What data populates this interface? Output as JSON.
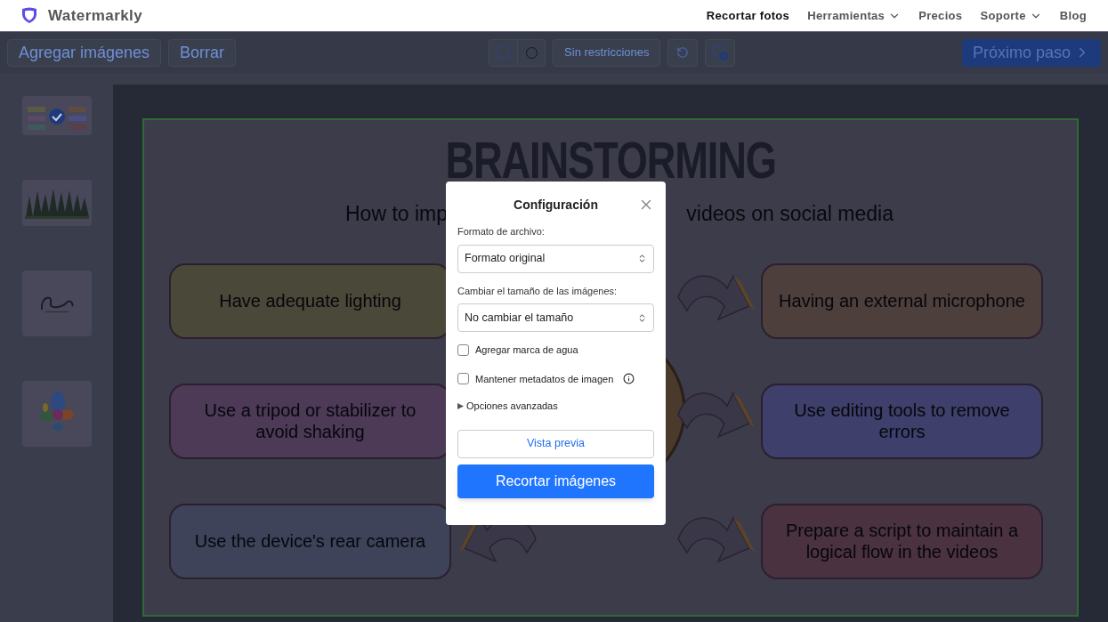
{
  "nav": {
    "brand": "Watermarkly",
    "links": [
      {
        "label": "Recortar fotos",
        "selected": true,
        "dropdown": false
      },
      {
        "label": "Herramientas",
        "selected": false,
        "dropdown": true
      },
      {
        "label": "Precios",
        "selected": false,
        "dropdown": false
      },
      {
        "label": "Soporte",
        "selected": false,
        "dropdown": true
      },
      {
        "label": "Blog",
        "selected": false,
        "dropdown": false
      }
    ]
  },
  "toolbar": {
    "add_button": "Agregar imágenes",
    "delete_button": "Borrar",
    "shapes": [
      {
        "kind": "rectangle",
        "selected": true
      },
      {
        "kind": "ellipse",
        "selected": false
      }
    ],
    "ratio_button": "Sin restricciones",
    "next_button": "Próximo paso"
  },
  "slide": {
    "title": "BRAINSTORMING",
    "subtitle_left": "How to imp",
    "subtitle_right": "videos on social media",
    "left_tips": [
      {
        "text": "Have adequate lighting",
        "color": "#4a4838"
      },
      {
        "text": "Use a tripod or stabilizer to avoid shaking",
        "color": "#4c3a57"
      },
      {
        "text": "Use the device's rear camera",
        "color": "#3e4359"
      }
    ],
    "right_tips": [
      {
        "text": "Having an external microphone",
        "color": "#4d3f3c"
      },
      {
        "text": "Use editing tools to remove errors",
        "color": "#3e3f6a"
      },
      {
        "text": "Prepare a script to maintain a logical flow in the videos",
        "color": "#4a3240"
      }
    ]
  },
  "dialog": {
    "title": "Configuración",
    "format_label": "Formato de archivo:",
    "format_value": "Formato original",
    "resize_label": "Cambiar el tamaño de las imágenes:",
    "resize_value": "No cambiar el tamaño",
    "options": [
      {
        "label": "Agregar marca de agua",
        "checked": false,
        "info": false
      },
      {
        "label": "Mantener metadatos de imagen",
        "checked": false,
        "info": true
      }
    ],
    "advanced": {
      "label": "Opciones avanzadas",
      "expanded": false
    },
    "preview_button": "Vista previa",
    "crop_button": "Recortar imágenes"
  }
}
